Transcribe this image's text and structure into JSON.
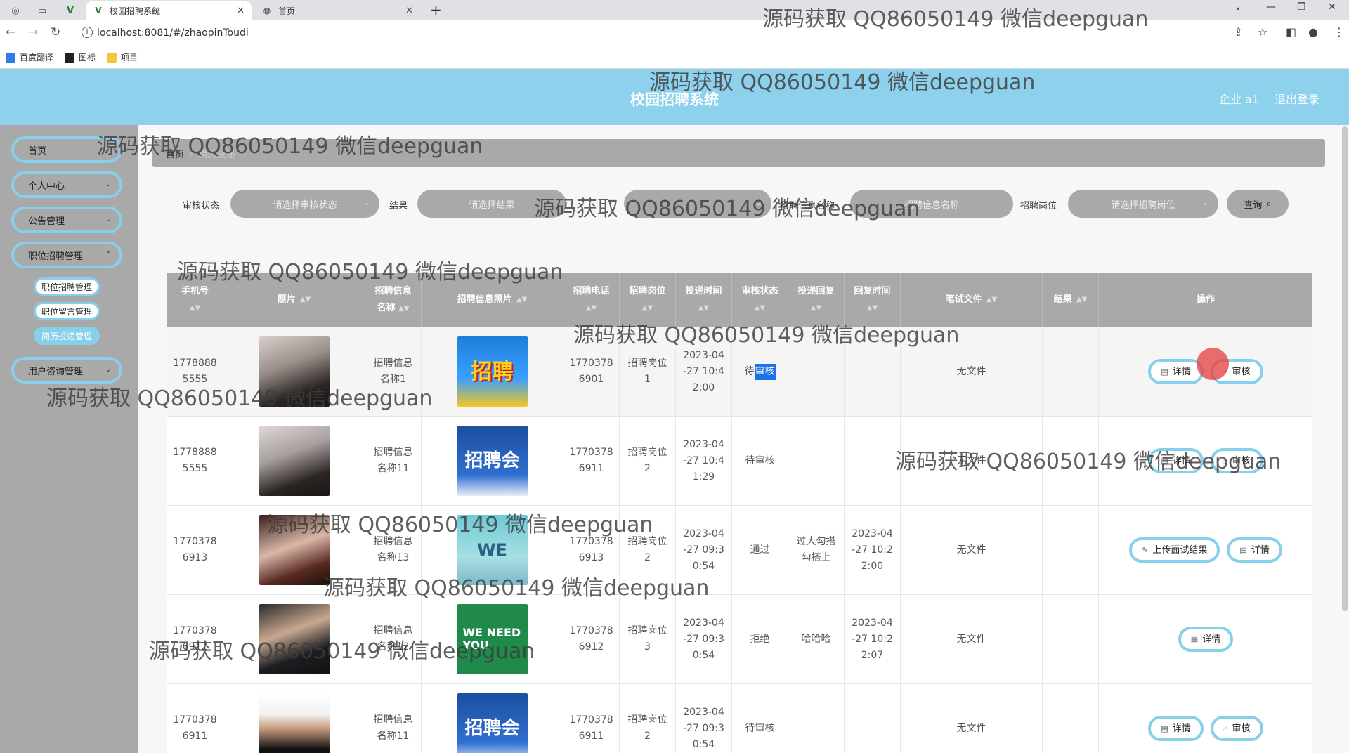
{
  "browser": {
    "tabs": [
      {
        "title": "校园招聘系统",
        "active": true
      },
      {
        "title": "首页",
        "active": false
      }
    ],
    "url": "localhost:8081/#/zhaopinToudi",
    "bookmarks": [
      "百度翻译",
      "图标",
      "项目"
    ]
  },
  "header": {
    "title": "校园招聘系统",
    "user": "企业 a1",
    "logout": "退出登录",
    "color": "#8ed1ec"
  },
  "sidebar": {
    "items": [
      {
        "label": "首页"
      },
      {
        "label": "个人中心"
      },
      {
        "label": "公告管理"
      },
      {
        "label": "职位招聘管理"
      },
      {
        "label": "用户咨询管理"
      }
    ],
    "sub_items": [
      {
        "label": "职位招聘管理",
        "active": false
      },
      {
        "label": "职位留言管理",
        "active": false
      },
      {
        "label": "简历投递管理",
        "active": true
      }
    ]
  },
  "breadcrumb": {
    "home": "首页",
    "sep": "/",
    "current": "简历投递"
  },
  "filters": {
    "status_label": "审核状态",
    "status_placeholder": "请选择审核状态",
    "result_label": "结果",
    "result_placeholder": "请选择结果",
    "info_name_label": "招聘信息名称",
    "info_name_placeholder": "招聘信息名称",
    "position_label": "招聘岗位",
    "position_placeholder": "请选择招聘岗位",
    "query_button": "查询"
  },
  "table": {
    "headers": {
      "phone": "手机号",
      "photo": "照片",
      "info_name_1": "招聘信息",
      "info_name_2": "名称",
      "info_photo": "招聘信息照片",
      "tel": "招聘电话",
      "position": "招聘岗位",
      "time": "投递时间",
      "status": "审核状态",
      "reply": "投递回复",
      "reply_time": "回复时间",
      "file": "笔试文件",
      "result": "结果",
      "ops": "操作"
    },
    "rows": [
      {
        "phone_1": "1778888",
        "phone_2": "5555",
        "name_1": "招聘信息",
        "name_2": "名称1",
        "poster": "招聘",
        "tel_1": "1770378",
        "tel_2": "6901",
        "pos_1": "招聘岗位",
        "pos_2": "1",
        "time_1": "2023-04",
        "time_2": "-27 10:4",
        "time_3": "2:00",
        "status_a": "待",
        "status_b": "审核",
        "reply": "",
        "rtime_1": "",
        "rtime_2": "",
        "rtime_3": "",
        "file": "无文件",
        "result": "",
        "btn_1": "详情",
        "btn_2": "审核"
      },
      {
        "phone_1": "1778888",
        "phone_2": "5555",
        "name_1": "招聘信息",
        "name_2": "名称11",
        "poster": "招聘会",
        "tel_1": "1770378",
        "tel_2": "6911",
        "pos_1": "招聘岗位",
        "pos_2": "2",
        "time_1": "2023-04",
        "time_2": "-27 10:4",
        "time_3": "1:29",
        "status": "待审核",
        "reply": "",
        "rtime_1": "",
        "rtime_2": "",
        "rtime_3": "",
        "file": "无文件",
        "result": "",
        "btn_1": "详情",
        "btn_2": "审核"
      },
      {
        "phone_1": "1770378",
        "phone_2": "6913",
        "name_1": "招聘信息",
        "name_2": "名称13",
        "poster": "WE",
        "tel_1": "1770378",
        "tel_2": "6913",
        "pos_1": "招聘岗位",
        "pos_2": "2",
        "time_1": "2023-04",
        "time_2": "-27 09:3",
        "time_3": "0:54",
        "status": "通过",
        "reply_1": "过大勾搭",
        "reply_2": "勾搭上",
        "rtime_1": "2023-04",
        "rtime_2": "-27 10:2",
        "rtime_3": "2:00",
        "file": "无文件",
        "result": "",
        "btn_1": "上传面试结果",
        "btn_2": "详情"
      },
      {
        "phone_1": "1770378",
        "phone_2": "6912",
        "name_1": "招聘信息",
        "name_2": "名称12",
        "poster": "WE NEED YOU",
        "tel_1": "1770378",
        "tel_2": "6912",
        "pos_1": "招聘岗位",
        "pos_2": "3",
        "time_1": "2023-04",
        "time_2": "-27 09:3",
        "time_3": "0:54",
        "status": "拒绝",
        "reply": "哈哈哈",
        "rtime_1": "2023-04",
        "rtime_2": "-27 10:2",
        "rtime_3": "2:07",
        "file": "无文件",
        "result": "",
        "btn_1": "详情"
      },
      {
        "phone_1": "1770378",
        "phone_2": "6911",
        "name_1": "招聘信息",
        "name_2": "名称11",
        "poster": "招聘会",
        "tel_1": "1770378",
        "tel_2": "6911",
        "pos_1": "招聘岗位",
        "pos_2": "2",
        "time_1": "2023-04",
        "time_2": "-27 09:3",
        "time_3": "0:54",
        "status": "待审核",
        "reply": "",
        "rtime_1": "",
        "rtime_2": "",
        "rtime_3": "",
        "file": "无文件",
        "result": "",
        "btn_1": "详情",
        "btn_2": "审核"
      }
    ]
  },
  "watermark": "源码获取 QQ86050149 微信deepguan"
}
